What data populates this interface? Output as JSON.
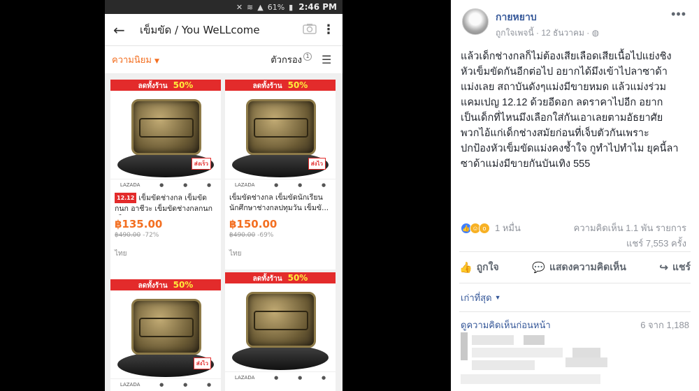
{
  "phone": {
    "status": {
      "battery": "61%",
      "time": "2:46 PM"
    },
    "search": {
      "query": "เข็มขัด / You WeLLcome"
    },
    "filters": {
      "sort_label": "ความนิยม",
      "filter_label": "ตัวกรอง",
      "filter_count": "1"
    },
    "products": [
      {
        "promo": "ลดทั้งร้าน",
        "promo_pct": "50%",
        "tag": "12.12",
        "title": "เข็มขัดช่างกล เข็มขัดกนก อาชีวะ เข็มขัดช่างกลกนก เข็...",
        "price": "฿135.00",
        "old_price": "฿490.00",
        "discount": "-72%",
        "country": "ไทย",
        "badge": "ส่งเร็ว"
      },
      {
        "promo": "ลดทั้งร้าน",
        "promo_pct": "50%",
        "tag": "",
        "title": "เข็มขัดช่างกล เข็มขัดนักเรียน นักศึกษาช่างกลปทุมวัน เข็มขั...",
        "price": "฿150.00",
        "old_price": "฿490.00",
        "discount": "-69%",
        "country": "ไทย",
        "badge": "ส่งไว"
      },
      {
        "promo": "ลดทั้งร้าน",
        "promo_pct": "50%",
        "badge": "ส่งไว"
      },
      {
        "promo": "ลดทั้งร้าน",
        "promo_pct": "50%",
        "badge": ""
      }
    ],
    "logo_text": "LAZADA"
  },
  "fb": {
    "author": "กายหยาบ",
    "meta": "ถูกใจเพจนี้ · 12 ธันวาคม ·",
    "post_lines": [
      "แล้วเด็กช่างกลก็ไม่ต้องเสียเลือดเสียเนื้อไปแย่งชิง",
      "หัวเข็มขัดกันอีกต่อไป อยากได้มึงเข้าไปลาซาด้า",
      "แม่งเลย สถาบันดังๆแม่งมีขายหมด แล้วแม่งร่วม",
      "แคมเปญ 12.12 ด้วยอีดอก ลดราคาไปอีก อยาก",
      "เป็นเด็กที่ไหนมึงเลือกใส่กันเอาเลยตามอัธยาศัย",
      "พวกไอ้แก่เด็กช่างสมัยก่อนที่เจ็บตัวกันเพราะ",
      "ปกป้องหัวเข็มขัดแม่งคงช้ำใจ กูทำไปทำไม ยุคนี้ลา",
      "ซาด้าแม่งมีขายกันบันเทิง 555"
    ],
    "reactions_count": "1 หมื่น",
    "comments_count": "ความคิดเห็น 1.1 พัน รายการ",
    "shares_count": "แชร์ 7,553 ครั้ง",
    "actions": {
      "like": "ถูกใจ",
      "comment": "แสดงความคิดเห็น",
      "share": "แชร์"
    },
    "sort": "เก่าที่สุด",
    "view_previous": "ดูความคิดเห็นก่อนหน้า",
    "comment_progress": "6 จาก 1,188"
  }
}
